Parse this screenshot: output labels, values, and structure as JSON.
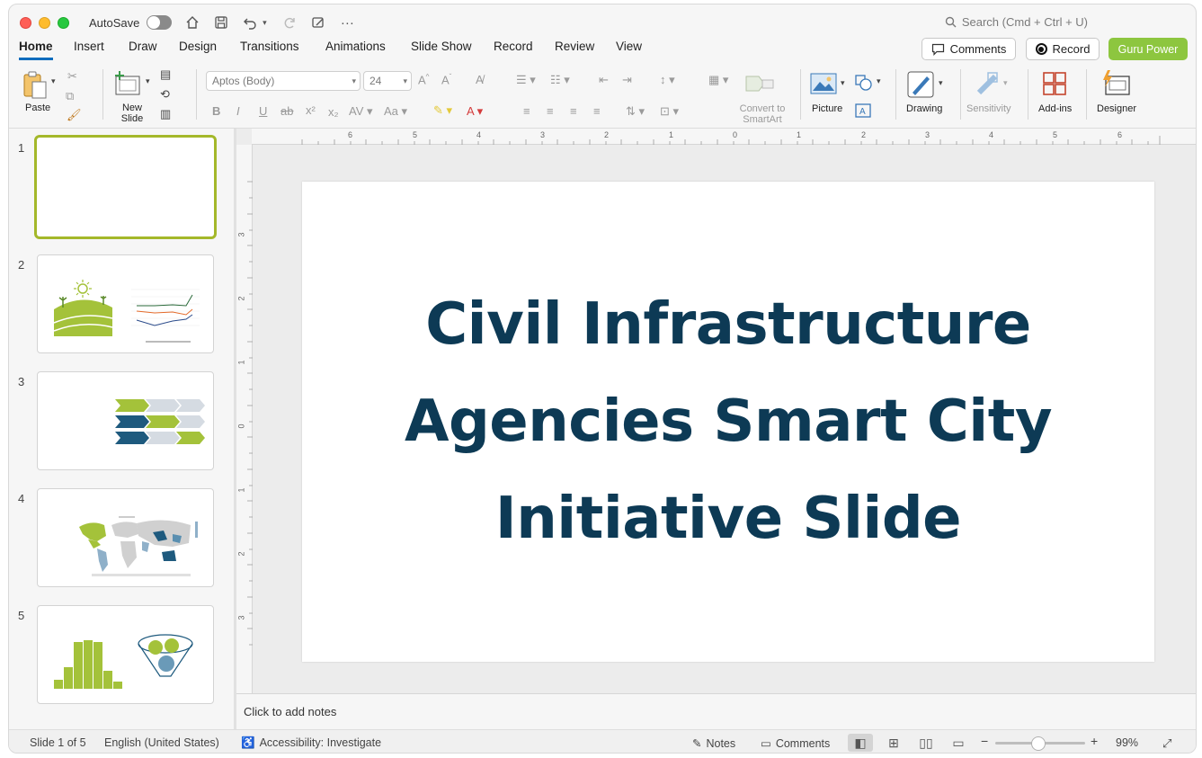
{
  "window": {
    "autosave_label": "AutoSave",
    "search_placeholder": "Search (Cmd + Ctrl + U)"
  },
  "menu": {
    "tabs": [
      "Home",
      "Insert",
      "Draw",
      "Design",
      "Transitions",
      "Animations",
      "Slide Show",
      "Record",
      "Review",
      "View"
    ],
    "active_tab": "Home",
    "comments_label": "Comments",
    "record_label": "Record",
    "guru_label": "Guru Power"
  },
  "ribbon": {
    "paste_label": "Paste",
    "new_slide_label": "New Slide",
    "font_name": "Aptos (Body)",
    "font_size": "24",
    "convert_smartart_label": "Convert to SmartArt",
    "picture_label": "Picture",
    "drawing_label": "Drawing",
    "sensitivity_label": "Sensitivity",
    "addins_label": "Add-ins",
    "designer_label": "Designer"
  },
  "thumbnails": [
    {
      "number": "1",
      "selected": true
    },
    {
      "number": "2",
      "selected": false
    },
    {
      "number": "3",
      "selected": false
    },
    {
      "number": "4",
      "selected": false
    },
    {
      "number": "5",
      "selected": false
    }
  ],
  "ruler": {
    "h_ticks": [
      "6",
      "5",
      "4",
      "3",
      "2",
      "1",
      "0",
      "1",
      "2",
      "3",
      "4",
      "5",
      "6"
    ],
    "v_ticks": [
      "3",
      "2",
      "1",
      "0",
      "1",
      "2",
      "3"
    ]
  },
  "slide": {
    "title": "Civil Infrastructure Agencies Smart City Initiative Slide"
  },
  "notes": {
    "placeholder": "Click to add notes"
  },
  "status": {
    "slide_counter": "Slide 1 of 5",
    "language": "English (United States)",
    "accessibility": "Accessibility: Investigate",
    "notes_label": "Notes",
    "comments_label": "Comments",
    "zoom": "99%"
  },
  "colors": {
    "accent_green": "#8dc63f",
    "title_navy": "#0d3a55",
    "tab_underline": "#0f6cbd",
    "thumb_select": "#a4b82a"
  }
}
